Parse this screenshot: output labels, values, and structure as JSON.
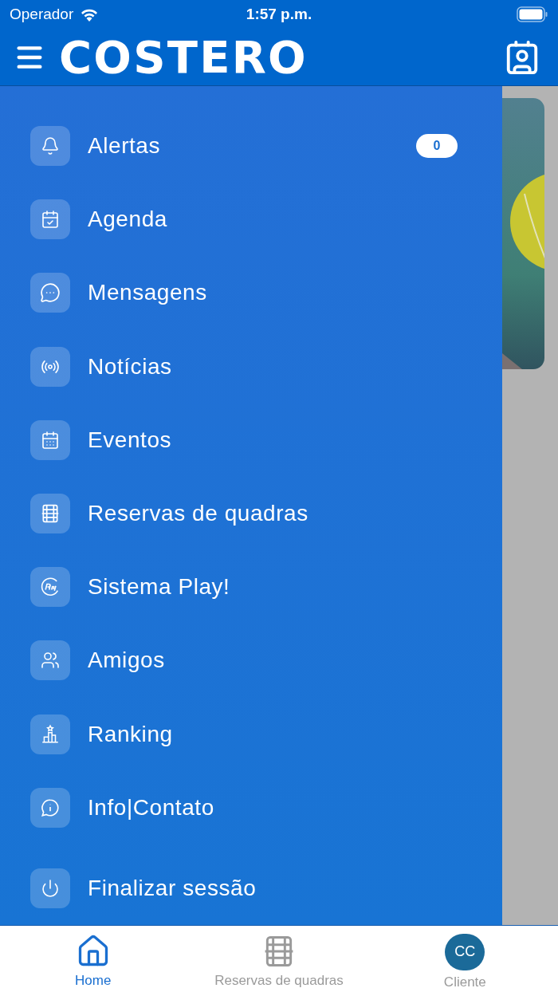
{
  "status_bar": {
    "carrier": "Operador",
    "time": "1:57 p.m."
  },
  "header": {
    "logo": "COSTERO"
  },
  "menu": [
    {
      "label": "Alertas",
      "badge": "0"
    },
    {
      "label": "Agenda"
    },
    {
      "label": "Mensagens"
    },
    {
      "label": "Notícias"
    },
    {
      "label": "Eventos"
    },
    {
      "label": "Reservas de quadras"
    },
    {
      "label": "Sistema Play!"
    },
    {
      "label": "Amigos"
    },
    {
      "label": "Ranking"
    },
    {
      "label": "Info|Contato"
    },
    {
      "label": "Finalizar sessão"
    }
  ],
  "tab_bar": [
    {
      "label": "Home",
      "selected": true
    },
    {
      "label": "Reservas de quadras",
      "selected": false
    },
    {
      "label": "Cliente",
      "selected": false,
      "avatar": "CC"
    }
  ]
}
